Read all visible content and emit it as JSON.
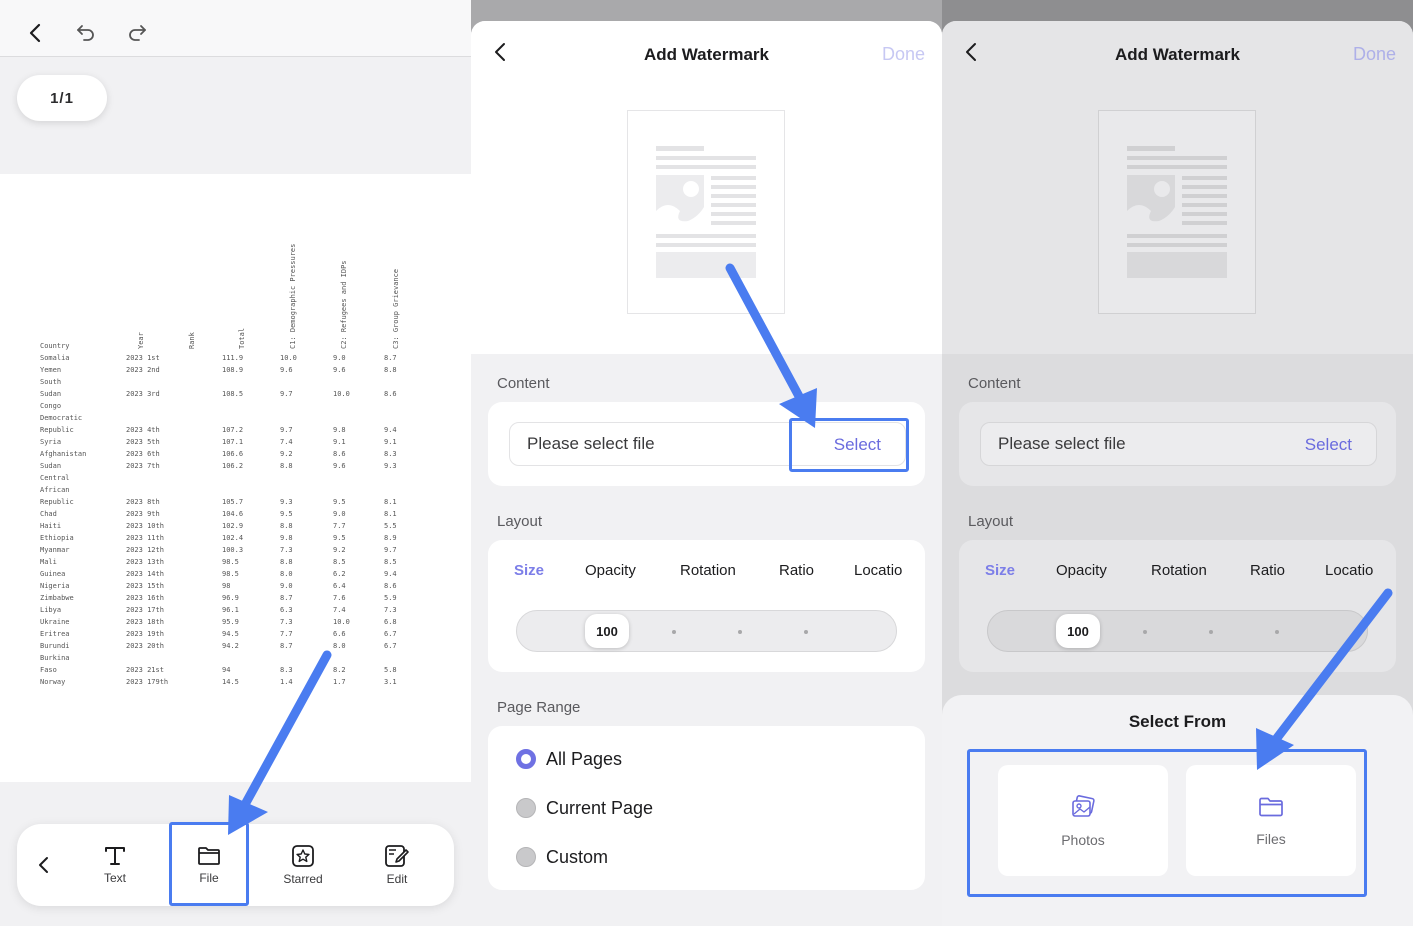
{
  "panel1": {
    "page_indicator": "1/1",
    "document": {
      "headers": {
        "country": "Country",
        "year": "Year",
        "rank": "Rank",
        "total": "Total",
        "c1": "C1: Demographic Pressures",
        "c2": "C2: Refugees and IDPs",
        "c3": "C3: Group Grievance"
      },
      "rows": [
        {
          "country": "Somalia",
          "yearrank": "2023 1st",
          "total": "111.9",
          "c1": "10.0",
          "c2": "9.0",
          "c3": "8.7"
        },
        {
          "country": "Yemen",
          "yearrank": "2023 2nd",
          "total": "108.9",
          "c1": "9.6",
          "c2": "9.6",
          "c3": "8.8"
        },
        {
          "country": "South Sudan",
          "yearrank": "2023 3rd",
          "total": "108.5",
          "c1": "9.7",
          "c2": "10.0",
          "c3": "8.6"
        },
        {
          "country": "Congo Democratic Republic",
          "yearrank": "2023 4th",
          "total": "107.2",
          "c1": "9.7",
          "c2": "9.8",
          "c3": "9.4"
        },
        {
          "country": "Syria",
          "yearrank": "2023 5th",
          "total": "107.1",
          "c1": "7.4",
          "c2": "9.1",
          "c3": "9.1"
        },
        {
          "country": "Afghanistan",
          "yearrank": "2023 6th",
          "total": "106.6",
          "c1": "9.2",
          "c2": "8.6",
          "c3": "8.3"
        },
        {
          "country": "Sudan",
          "yearrank": "2023 7th",
          "total": "106.2",
          "c1": "8.8",
          "c2": "9.6",
          "c3": "9.3"
        },
        {
          "country": "Central African Republic",
          "yearrank": "2023 8th",
          "total": "105.7",
          "c1": "9.3",
          "c2": "9.5",
          "c3": "8.1"
        },
        {
          "country": "Chad",
          "yearrank": "2023 9th",
          "total": "104.6",
          "c1": "9.5",
          "c2": "9.0",
          "c3": "8.1"
        },
        {
          "country": "Haiti",
          "yearrank": "2023 10th",
          "total": "102.9",
          "c1": "8.8",
          "c2": "7.7",
          "c3": "5.5"
        },
        {
          "country": "Ethiopia",
          "yearrank": "2023 11th",
          "total": "102.4",
          "c1": "9.8",
          "c2": "9.5",
          "c3": "8.9"
        },
        {
          "country": "Myanmar",
          "yearrank": "2023 12th",
          "total": "100.3",
          "c1": "7.3",
          "c2": "9.2",
          "c3": "9.7"
        },
        {
          "country": "Mali",
          "yearrank": "2023 13th",
          "total": "98.5",
          "c1": "8.8",
          "c2": "8.5",
          "c3": "8.5"
        },
        {
          "country": "Guinea",
          "yearrank": "2023 14th",
          "total": "98.5",
          "c1": "8.0",
          "c2": "6.2",
          "c3": "9.4"
        },
        {
          "country": "Nigeria",
          "yearrank": "2023 15th",
          "total": "98",
          "c1": "9.0",
          "c2": "6.4",
          "c3": "8.6"
        },
        {
          "country": "Zimbabwe",
          "yearrank": "2023 16th",
          "total": "96.9",
          "c1": "8.7",
          "c2": "7.6",
          "c3": "5.9"
        },
        {
          "country": "Libya",
          "yearrank": "2023 17th",
          "total": "96.1",
          "c1": "6.3",
          "c2": "7.4",
          "c3": "7.3"
        },
        {
          "country": "Ukraine",
          "yearrank": "2023 18th",
          "total": "95.9",
          "c1": "7.3",
          "c2": "10.0",
          "c3": "6.8"
        },
        {
          "country": "Eritrea",
          "yearrank": "2023 19th",
          "total": "94.5",
          "c1": "7.7",
          "c2": "6.6",
          "c3": "6.7"
        },
        {
          "country": "Burundi",
          "yearrank": "2023 20th",
          "total": "94.2",
          "c1": "8.7",
          "c2": "8.0",
          "c3": "6.7"
        },
        {
          "country": "Burkina Faso",
          "yearrank": "2023 21st",
          "total": "94",
          "c1": "8.3",
          "c2": "8.2",
          "c3": "5.8"
        },
        {
          "country": "Norway",
          "yearrank": "2023 179th",
          "total": "14.5",
          "c1": "1.4",
          "c2": "1.7",
          "c3": "3.1"
        }
      ]
    },
    "toolbar": {
      "text_label": "Text",
      "file_label": "File",
      "starred_label": "Starred",
      "edit_label": "Edit"
    }
  },
  "watermark_dialog": {
    "title": "Add Watermark",
    "done_label": "Done",
    "content_label": "Content",
    "file_placeholder": "Please select file",
    "select_label": "Select",
    "layout_label": "Layout",
    "layout_tabs": [
      "Size",
      "Opacity",
      "Rotation",
      "Ratio",
      "Locatio"
    ],
    "size_value": "100",
    "page_range_label": "Page Range",
    "page_range_options": [
      "All Pages",
      "Current Page",
      "Custom"
    ],
    "page_range_selected": "All Pages"
  },
  "select_from": {
    "title": "Select From",
    "photos_label": "Photos",
    "files_label": "Files"
  },
  "colors": {
    "accent": "#6f71e3",
    "highlight": "#4a7cf0",
    "done_disabled": "#c7c8f3"
  }
}
